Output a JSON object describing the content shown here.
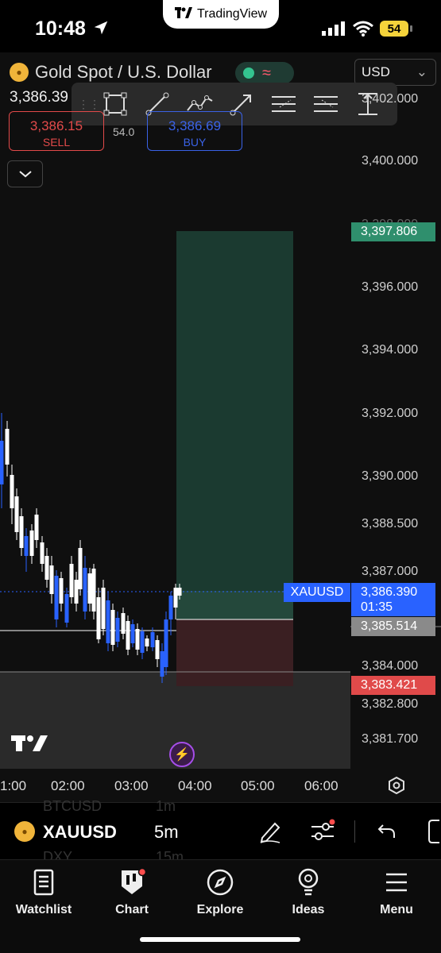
{
  "status": {
    "time": "10:48",
    "app_pill": "TradingView",
    "battery": "54"
  },
  "header": {
    "symbol_title": "Gold Spot / U.S. Dollar",
    "currency": "USD",
    "last_price_partial": "3,386.39",
    "sell_price": "3,386.15",
    "sell_label": "SELL",
    "spread": "54.0",
    "buy_price": "3,386.69",
    "buy_label": "BUY"
  },
  "toolbar": {
    "tools": [
      "rectangle",
      "trend-line",
      "polyline",
      "arrow",
      "long-position",
      "short-position",
      "price-range"
    ]
  },
  "price_axis": {
    "labels": [
      "3,402.000",
      "3,400.000",
      "3,398.000",
      "3,396.000",
      "3,394.000",
      "3,392.000",
      "3,390.000",
      "3,388.500",
      "3,387.000",
      "3,384.000",
      "3,382.800",
      "3,381.700"
    ],
    "target_tag": "3,397.806",
    "current_symbol": "XAUUSD",
    "current_price": "3,386.390",
    "countdown": "01:35",
    "entry_tag": "3,385.514",
    "stop_tag": "3,383.421"
  },
  "time_axis": {
    "labels": [
      "1:00",
      "02:00",
      "03:00",
      "04:00",
      "05:00",
      "06:00"
    ]
  },
  "symbol_bar": {
    "symbol": "XAUUSD",
    "timeframe": "5m",
    "ghost_top_symbol": "BTCUSD",
    "ghost_top_tf": "1m",
    "ghost_bottom_symbol": "DXY",
    "ghost_bottom_tf": "15m"
  },
  "tabs": {
    "watchlist": "Watchlist",
    "chart": "Chart",
    "explore": "Explore",
    "ideas": "Ideas",
    "menu": "Menu"
  },
  "colors": {
    "up_candle": "#ffffff",
    "down_candle": "#2962ff",
    "target_zone": "#1b3a30",
    "stop_zone": "#3a1f22",
    "accent_blue": "#2962ff",
    "sell_red": "#e24a4a",
    "target_green": "#2f8f6d"
  }
}
